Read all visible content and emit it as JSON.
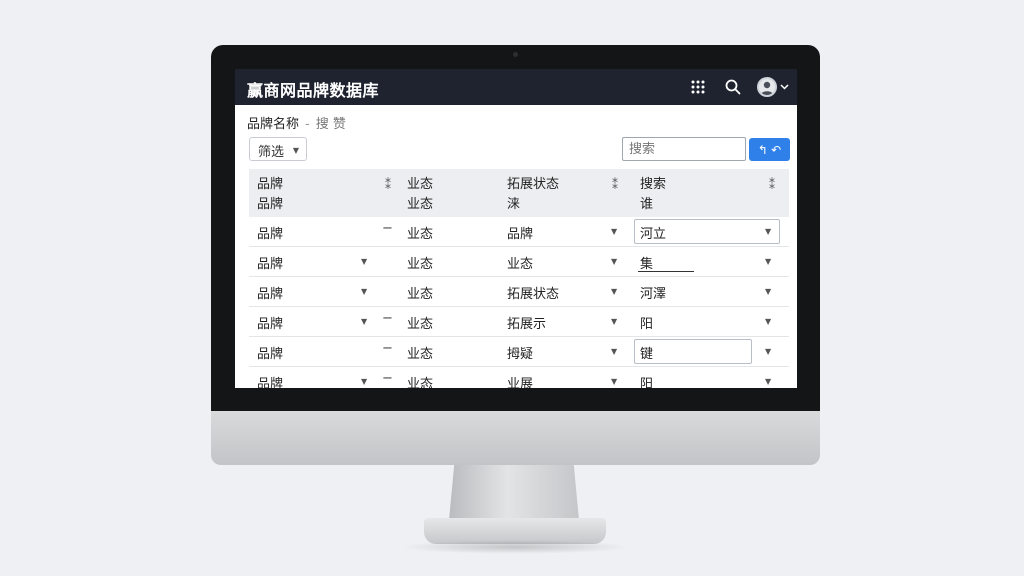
{
  "app": {
    "title": "赢商网品牌数据库"
  },
  "header_icons": [
    "apps-grid-icon",
    "search-icon",
    "user-avatar-icon",
    "chevron-down-icon"
  ],
  "breadcrumb": {
    "current": "品牌名称",
    "separator": "-",
    "sub": "搜 赞"
  },
  "toolbar": {
    "filter_label": "筛选",
    "search_placeholder": "搜索",
    "search_button_label": "↰ ↶"
  },
  "table": {
    "headers": [
      {
        "line1": "品牌",
        "line2": "品牌",
        "sort": "⁑"
      },
      {
        "line1": "业态",
        "line2": "业态",
        "sort": ""
      },
      {
        "line1": "拓展状态",
        "line2": "涞",
        "sort": "⁑"
      },
      {
        "line1": "搜索",
        "line2": "谁",
        "sort": "⁑"
      }
    ],
    "rows": [
      {
        "c1": "品牌",
        "c2": "业态",
        "c3": "品牌",
        "c4": "河立"
      },
      {
        "c1": "品牌",
        "c2": "业态",
        "c3": "业态",
        "c4": "集"
      },
      {
        "c1": "品牌",
        "c2": "业态",
        "c3": "拓展状态",
        "c4": "河澤"
      },
      {
        "c1": "品牌",
        "c2": "业态",
        "c3": "拓展示",
        "c4": "阳"
      },
      {
        "c1": "品牌",
        "c2": "业态",
        "c3": "拇疑",
        "c4": "键"
      },
      {
        "c1": "品牌",
        "c2": "业态",
        "c3": "业展",
        "c4": "阳"
      }
    ]
  },
  "colors": {
    "appbar": "#1f2330",
    "accent": "#2f80e8"
  }
}
